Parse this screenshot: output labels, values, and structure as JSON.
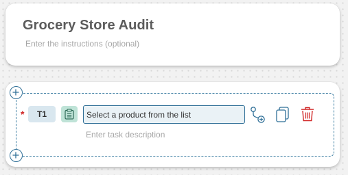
{
  "header": {
    "title": "Grocery Store Audit",
    "instructions_placeholder": "Enter the instructions (optional)"
  },
  "task": {
    "required_marker": "*",
    "id_label": "T1",
    "type_icon": "clipboard-icon",
    "input_value": "Select a product from the list",
    "description_placeholder": "Enter task description",
    "actions": [
      "branch-icon",
      "copy-icon",
      "delete-icon"
    ]
  },
  "colors": {
    "accent": "#2f6f97",
    "task_id_bg": "#d9e7ef",
    "task_type_bg": "#bfe3d7",
    "delete": "#d02424"
  }
}
